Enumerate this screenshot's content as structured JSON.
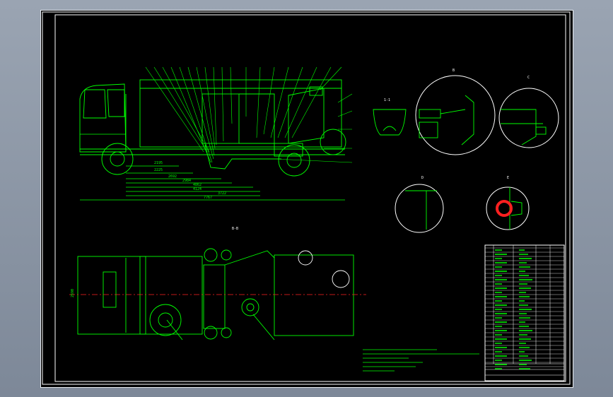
{
  "viewer": {
    "background": "#8d97a6",
    "sheet_background": "#000000"
  },
  "colors": {
    "frame": "#ffffff",
    "outline": "#ffffff",
    "geometry": "#00ff00",
    "centerline": "#ff2020",
    "annotation": "#ffff00",
    "hatch": "#ff2020"
  },
  "dimensions": {
    "front_overhang": "2195",
    "d1": "2225",
    "d2": "2692",
    "d3": "2984",
    "d4": "4862",
    "d5": "4124",
    "d6": "3722",
    "overall": "7767",
    "width": "2590"
  },
  "views": {
    "elevation_note": "1-1",
    "plan_label": "B-B",
    "detail_a": "A",
    "detail_b": "B",
    "detail_c": "C",
    "detail_d": "D",
    "detail_e": "E"
  },
  "title_block": {
    "drawing_name": "扫路车总图",
    "scale": "1:20"
  }
}
